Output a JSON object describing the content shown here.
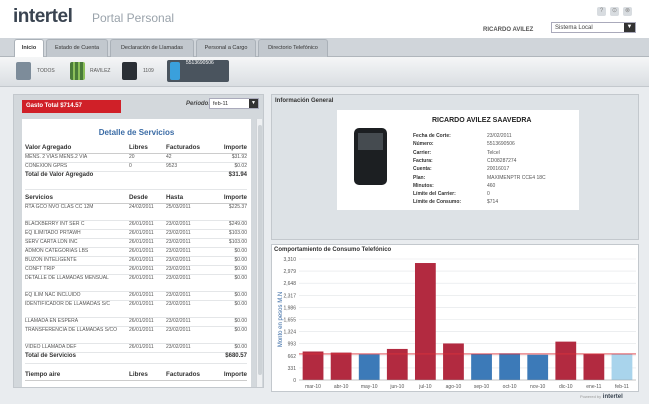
{
  "header": {
    "logo": "intertel",
    "subtitle": "Portal Personal",
    "user": "RICARDO AVILEZ",
    "system_select": "Sistema Local",
    "top_icons": [
      "?",
      "⊙",
      "⊗"
    ]
  },
  "tabs": [
    {
      "label": "Inicio",
      "active": true
    },
    {
      "label": "Estado de Cuenta"
    },
    {
      "label": "Declaración de Llamadas"
    },
    {
      "label": "Personal a Cargo"
    },
    {
      "label": "Directorio Telefónico"
    }
  ],
  "lines": {
    "items": [
      "TODOS",
      "RAVILEZ",
      "1109",
      "5513690506"
    ],
    "selected": "5513690506"
  },
  "left": {
    "gasto": "Gasto Total  $714.57",
    "periodo_label": "Periodo:",
    "periodo_value": "feb-11",
    "detalle_title": "Detalle de Servicios",
    "valor_header": [
      "Valor Agregado",
      "Libres",
      "Facturados",
      "Importe"
    ],
    "valor_rows": [
      [
        "MENS. 2 VIAS MENS.2 VIA",
        "20",
        "42",
        "$31.92"
      ],
      [
        "CONEXION GPRS",
        "0",
        "9523",
        "$0.02"
      ]
    ],
    "valor_total": [
      "Total de Valor Agregado",
      "$31.94"
    ],
    "serv_header": [
      "Servicios",
      "Desde",
      "Hasta",
      "Importe"
    ],
    "serv_rows": [
      [
        "RTA GCO NVO CLAS CC 12M",
        "24/02/2011",
        "25/03/2011",
        "$225.37"
      ],
      [
        "BLACKBERRY INT SER C",
        "26/01/2011",
        "23/02/2011",
        "$249.00"
      ],
      [
        "EQ ILIMITADO PRTAWH",
        "26/01/2011",
        "23/02/2011",
        "$103.00"
      ],
      [
        "SERV CARTA LDN INC",
        "26/01/2011",
        "23/02/2011",
        "$103.00"
      ],
      [
        "ADMON CATEGORIAS LBS",
        "26/01/2011",
        "23/02/2011",
        "$0.00"
      ],
      [
        "BUZON INTELIGENTE",
        "26/01/2011",
        "23/02/2011",
        "$0.00"
      ],
      [
        "CONFT TRIP",
        "26/01/2011",
        "23/02/2011",
        "$0.00"
      ],
      [
        "DETALLE DE LLAMADAS MENSUAL",
        "26/01/2011",
        "23/02/2011",
        "$0.00"
      ],
      [
        "EQ ILIM NAC INCLUIDO",
        "26/01/2011",
        "23/02/2011",
        "$0.00"
      ],
      [
        "IDENTIFICADOR DE LLAMADAS S/C",
        "26/01/2011",
        "23/02/2011",
        "$0.00"
      ],
      [
        "LLAMADA EN ESPERA",
        "26/01/2011",
        "23/02/2011",
        "$0.00"
      ],
      [
        "TRANSFERENCIA DE LLAMADAS S/CO",
        "26/01/2011",
        "23/02/2011",
        "$0.00"
      ],
      [
        "VIDEO LLAMADA DEF",
        "26/01/2011",
        "23/02/2011",
        "$0.00"
      ]
    ],
    "serv_total": [
      "Total de Servicios",
      "$680.57"
    ],
    "aire_header": [
      "Tiempo aire",
      "Libres",
      "Facturados",
      "Importe"
    ]
  },
  "info": {
    "title": "Información General",
    "name": "RICARDO AVILEZ SAAVEDRA",
    "fields": [
      [
        "Fecha de Corte:",
        "23/02/2011"
      ],
      [
        "Número:",
        "5513690506"
      ],
      [
        "Carrier:",
        "Telcel"
      ],
      [
        "Factura:",
        "CD08287274"
      ],
      [
        "Cuenta:",
        "20016017"
      ],
      [
        "Plan:",
        "MAXIMENPTR CCE4 18C"
      ],
      [
        "Minutos:",
        "460"
      ],
      [
        "Límite del Carrier:",
        "0"
      ],
      [
        "Límite de Consumo:",
        "$714"
      ]
    ]
  },
  "chart_section_title": "Comportamiento de Consumo Telefónico",
  "chart_data": {
    "type": "bar",
    "ylabel": "Monto en pesos M.N",
    "ylim": [
      0,
      3310
    ],
    "yticks": [
      "3,310",
      "2,979",
      "2,648",
      "2,317",
      "1,986",
      "1,655",
      "1,324",
      "993",
      "662",
      "331",
      "0"
    ],
    "categories": [
      "mar-10",
      "abr-10",
      "may-10",
      "jun-10",
      "jul-10",
      "ago-10",
      "sep-10",
      "oct-10",
      "nov-10",
      "dic-10",
      "ene-11",
      "feb-11"
    ],
    "values": [
      780,
      750,
      700,
      850,
      3200,
      1000,
      720,
      730,
      690,
      1050,
      710,
      714
    ],
    "colors": [
      "#b22a40",
      "#b22a40",
      "#3c7ab8",
      "#b22a40",
      "#b22a40",
      "#b22a40",
      "#3c7ab8",
      "#3c7ab8",
      "#3c7ab8",
      "#b22a40",
      "#b22a40",
      "#a9d4ec"
    ],
    "reference_line": 714,
    "reference_color": "#d9303a",
    "grid": true
  },
  "footer": {
    "powered": "Powered by",
    "brand": "intertel"
  }
}
